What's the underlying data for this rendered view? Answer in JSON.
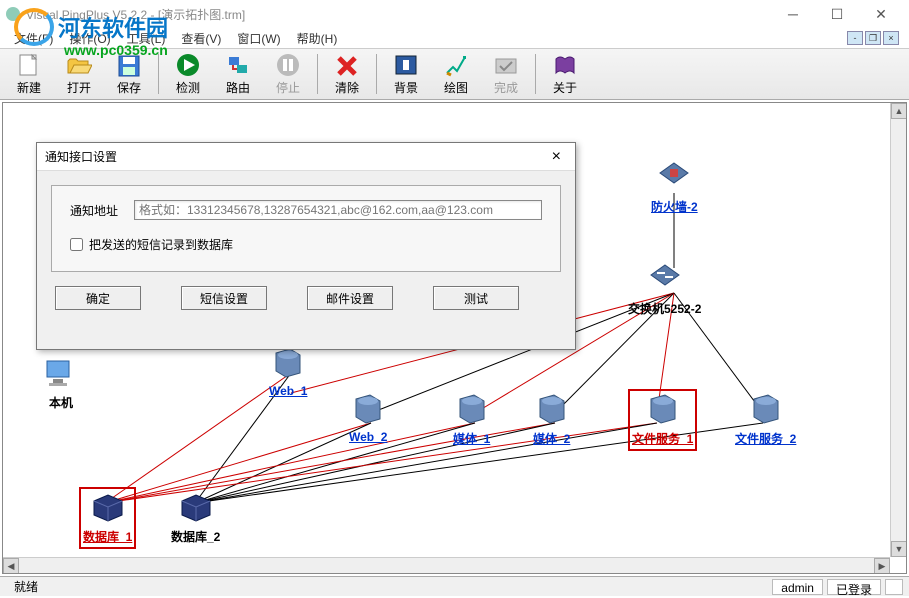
{
  "window": {
    "title": "Visual PingPlus V5.2.2 - [演示拓扑图.trm]"
  },
  "watermark": {
    "brand": "河东软件园",
    "url": "www.pc0359.cn"
  },
  "menu": {
    "file": "文件(F)",
    "operate": "操作(O)",
    "tool": "工具(L)",
    "view": "查看(V)",
    "window": "窗口(W)",
    "help": "帮助(H)"
  },
  "toolbar": {
    "new": "新建",
    "open": "打开",
    "save": "保存",
    "detect": "检测",
    "route": "路由",
    "stop": "停止",
    "clear": "清除",
    "background": "背景",
    "draw": "绘图",
    "finish": "完成",
    "about": "关于"
  },
  "dialog": {
    "title": "通知接口设置",
    "addr_label": "通知地址",
    "addr_placeholder": "格式如：13312345678,13287654321,abc@162.com,aa@123.com",
    "checkbox": "把发送的短信记录到数据库",
    "ok": "确定",
    "sms": "短信设置",
    "mail": "邮件设置",
    "test": "测试"
  },
  "nodes": {
    "local": "本机",
    "firewall": "防火墙-2",
    "switch": "交换机5252-2",
    "web1": "Web_1",
    "web2": "Web_2",
    "media1": "媒体_1",
    "media2": "媒体_2",
    "file1": "文件服务_1",
    "file2": "文件服务_2",
    "db1": "数据库_1",
    "db2": "数据库_2"
  },
  "status": {
    "ready": "就绪",
    "user": "admin",
    "login": "已登录"
  }
}
